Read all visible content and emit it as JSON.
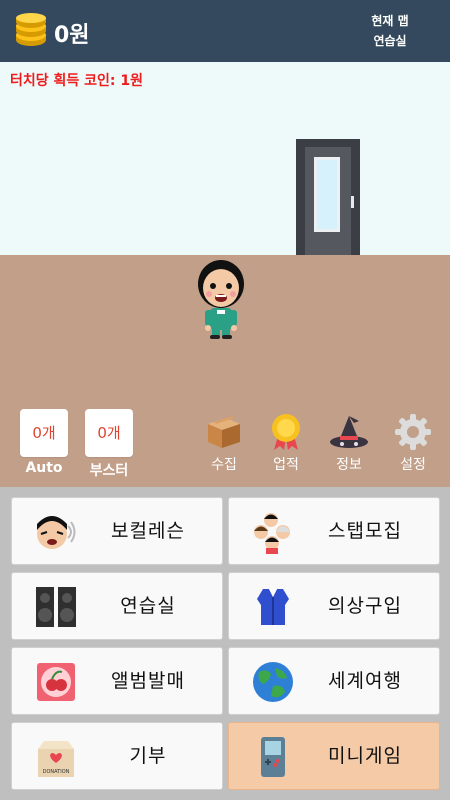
{
  "header": {
    "money": "0원",
    "map_label_1": "현재 맵",
    "map_label_2": "연습실"
  },
  "stage": {
    "coin_per_touch": "터치당 획득 코인: 1원"
  },
  "counters": [
    {
      "value": "0개",
      "label": "Auto"
    },
    {
      "value": "0개",
      "label": "부스터"
    }
  ],
  "toolbar": [
    {
      "label": "수집",
      "icon": "package-icon"
    },
    {
      "label": "업적",
      "icon": "medal-icon"
    },
    {
      "label": "정보",
      "icon": "witch-hat-icon"
    },
    {
      "label": "설정",
      "icon": "gear-icon"
    }
  ],
  "menu": [
    {
      "label": "보컬레슨",
      "icon": "singer-face-icon"
    },
    {
      "label": "스탭모집",
      "icon": "staff-group-icon"
    },
    {
      "label": "연습실",
      "icon": "speakers-icon"
    },
    {
      "label": "의상구입",
      "icon": "vest-icon"
    },
    {
      "label": "앨범발매",
      "icon": "album-icon"
    },
    {
      "label": "세계여행",
      "icon": "globe-icon"
    },
    {
      "label": "기부",
      "icon": "donation-box-icon",
      "icon_text": "DONATION"
    },
    {
      "label": "미니게임",
      "icon": "handheld-console-icon"
    }
  ],
  "colors": {
    "topbar": "#34495e",
    "sky": "#eef9fa",
    "floor": "#c29f89",
    "accent_red": "#ee1c1c",
    "highlight_button": "#f5cba7"
  }
}
